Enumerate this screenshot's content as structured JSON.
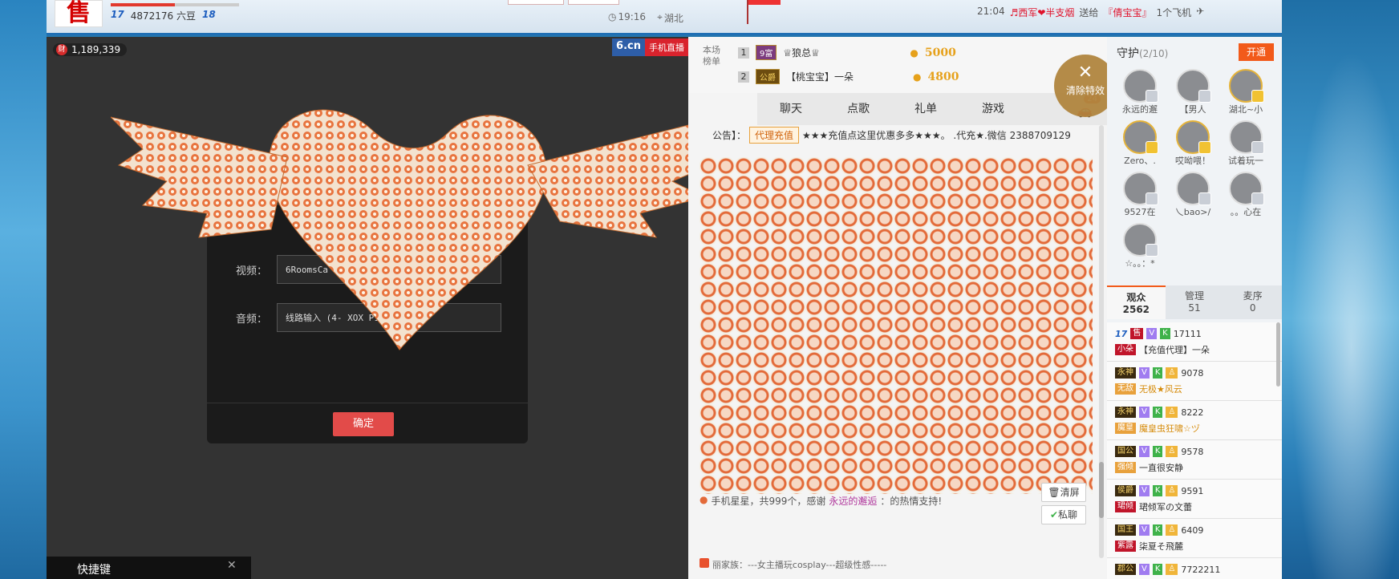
{
  "topbar": {
    "logo_char": "售",
    "level_from": "17",
    "balance": "4872176 六豆",
    "level_to": "18",
    "level_progress": 0.5,
    "time": "19:16",
    "location": "湖北",
    "broadcast_time": "21:04",
    "broadcast_sender": "♬西军❤半支烟",
    "broadcast_verb": "送给",
    "broadcast_target": "『倩宝宝』",
    "broadcast_gift": "1个飞机"
  },
  "video": {
    "wealth": "1,189,339",
    "wealth_icon": "财",
    "brand_logo": "6.cn",
    "brand_mobile": "手机直播",
    "dialog": {
      "video_label": "视频：",
      "video_value": "6RoomsCa",
      "audio_label": "音频：",
      "audio_value": "线路输入 (4- XOX P10 1",
      "confirm": "确定"
    },
    "hotkey_panel": "快捷键"
  },
  "chat": {
    "rank_label": "本场榜单",
    "rank": [
      {
        "num": "1",
        "badge": "9富",
        "name": "♕狼总♕",
        "coins": "5000"
      },
      {
        "num": "2",
        "badge": "公爵",
        "name": "【桃宝宝】一朵",
        "coins": "4800"
      }
    ],
    "clear_effects": "清除特效",
    "tabs": [
      "聊天",
      "点歌",
      "礼单",
      "游戏"
    ],
    "car_count": "24",
    "notice_prefix": "公告】：",
    "notice_tag": "代理充值",
    "notice_text": "★★★充值点这里优惠多多★★★。 .代充★.微信 2388709129",
    "thanks_prefix": "手机星星，共999个，感谢",
    "thanks_user": "永远的邂逅",
    "thanks_suffix": "：的热情支持!",
    "btn_clear": "清屏",
    "btn_private": "私聊",
    "ticker_text": "丽家族：---女主播玩cosplay---超级性感-----"
  },
  "side": {
    "guard_title": "守护",
    "guard_count": "(2/10)",
    "open_btn": "开通",
    "guards": [
      {
        "name": "永远的邂",
        "gold": false
      },
      {
        "name": "【男人",
        "gold": false
      },
      {
        "name": "湖北~小",
        "gold": true
      },
      {
        "name": "Zero、.",
        "gold": true
      },
      {
        "name": "哎呦喂！",
        "gold": true
      },
      {
        "name": "试着玩一",
        "gold": false
      },
      {
        "name": "9527在",
        "gold": false
      },
      {
        "name": "乀bao>/",
        "gold": false
      },
      {
        "name": "。。心在",
        "gold": false
      },
      {
        "name": "☆。。：*",
        "gold": false
      }
    ],
    "aud_tabs": [
      {
        "label": "观众",
        "count": "2562"
      },
      {
        "label": "管理",
        "count": "51"
      },
      {
        "label": "麦序",
        "count": "0"
      }
    ],
    "audience": [
      {
        "level": "17",
        "badge": "售",
        "id": "17111",
        "tag": "小朵",
        "name": "【充值代理】一朵",
        "gold": false
      },
      {
        "level": "永神",
        "badge": "",
        "id": "9078",
        "tag": "无敌",
        "name": "无极★风云",
        "gold": true
      },
      {
        "level": "永神",
        "badge": "",
        "id": "8222",
        "tag": "魔皇",
        "name": "魔皇虫狂啸☆ヅ",
        "gold": true
      },
      {
        "level": "国公",
        "badge": "",
        "id": "9578",
        "tag": "强倾",
        "name": "一直很安静",
        "gold": false
      },
      {
        "level": "侯爵",
        "badge": "",
        "id": "9591",
        "tag": "珺倾",
        "name": "珺倾军の文蕾",
        "gold": false
      },
      {
        "level": "国王",
        "badge": "",
        "id": "6409",
        "tag": "紫露",
        "name": "柒夏そ飛麓",
        "gold": false
      },
      {
        "level": "郡公",
        "badge": "",
        "id": "7722211",
        "tag": "",
        "name": "",
        "gold": false
      }
    ]
  }
}
